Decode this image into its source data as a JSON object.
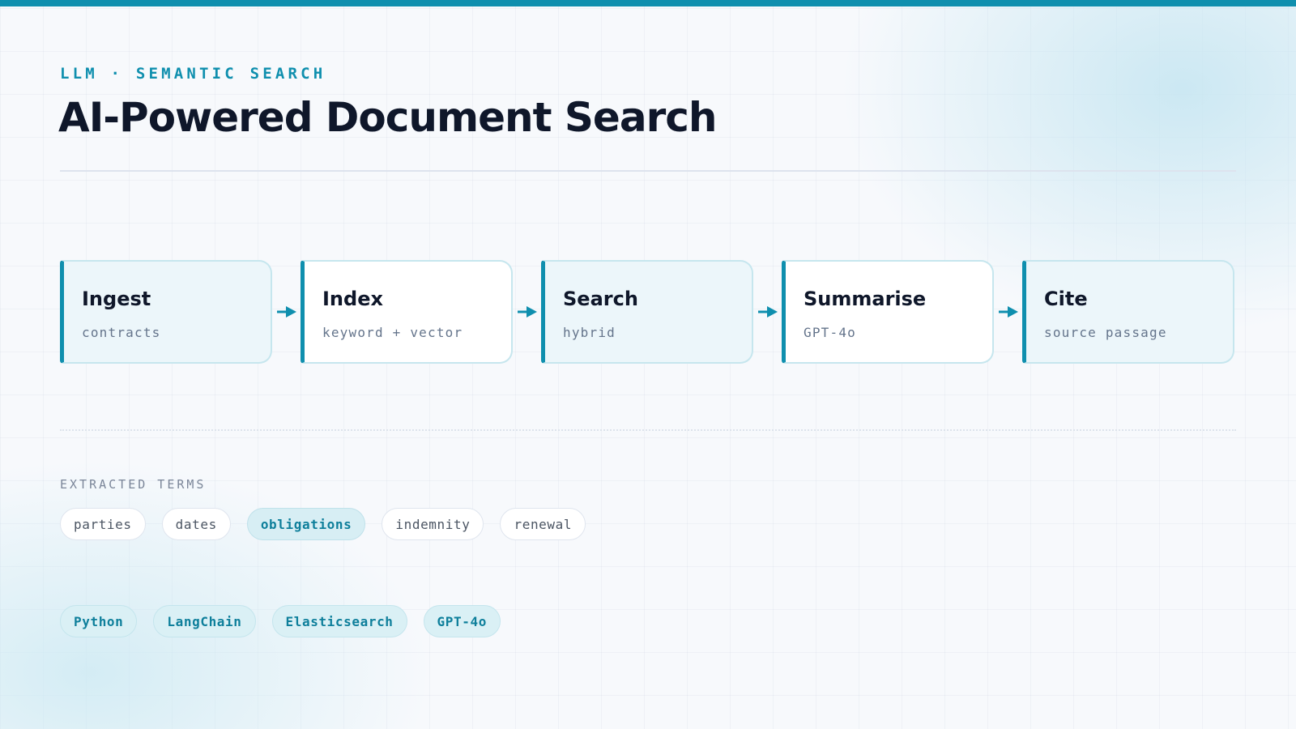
{
  "header": {
    "eyebrow": "LLM · SEMANTIC SEARCH",
    "title": "AI-Powered Document Search"
  },
  "pipeline": {
    "steps": [
      {
        "title": "Ingest",
        "subtitle": "contracts"
      },
      {
        "title": "Index",
        "subtitle": "keyword + vector"
      },
      {
        "title": "Search",
        "subtitle": "hybrid"
      },
      {
        "title": "Summarise",
        "subtitle": "GPT-4o"
      },
      {
        "title": "Cite",
        "subtitle": "source passage"
      }
    ]
  },
  "terms": {
    "label": "EXTRACTED TERMS",
    "items": [
      "parties",
      "dates",
      "obligations",
      "indemnity",
      "renewal"
    ],
    "highlighted": "obligations"
  },
  "tech": {
    "items": [
      "Python",
      "LangChain",
      "Elasticsearch",
      "GPT-4o"
    ]
  },
  "colors": {
    "accent": "#0f8fae",
    "title": "#0f172a",
    "muted": "#64748b"
  }
}
